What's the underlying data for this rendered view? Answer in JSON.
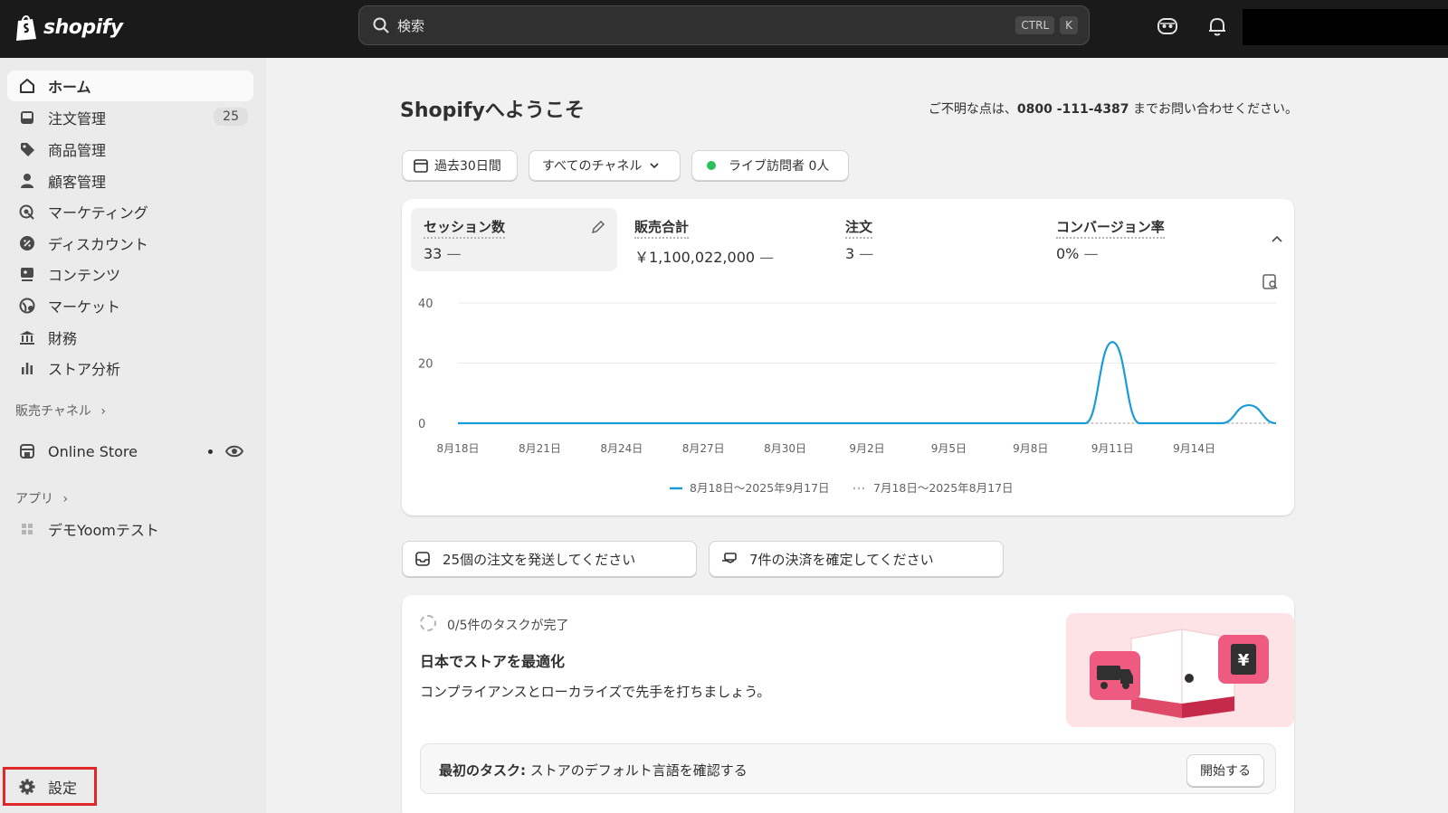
{
  "topbar": {
    "brand": "shopify",
    "search": {
      "placeholder": "検索",
      "shortcut_ctrl": "CTRL",
      "shortcut_key": "K"
    }
  },
  "sidebar": {
    "items": [
      {
        "label": "ホーム",
        "icon": "home-icon",
        "active": true
      },
      {
        "label": "注文管理",
        "icon": "inbox-icon",
        "badge": "25"
      },
      {
        "label": "商品管理",
        "icon": "tag-icon"
      },
      {
        "label": "顧客管理",
        "icon": "person-icon"
      },
      {
        "label": "マーケティング",
        "icon": "target-icon"
      },
      {
        "label": "ディスカウント",
        "icon": "discount-icon"
      },
      {
        "label": "コンテンツ",
        "icon": "content-icon"
      },
      {
        "label": "マーケット",
        "icon": "globe-icon"
      },
      {
        "label": "財務",
        "icon": "bank-icon"
      },
      {
        "label": "ストア分析",
        "icon": "bar-chart-icon"
      }
    ],
    "sales_channels_label": "販売チャネル",
    "online_store_label": "Online Store",
    "apps_label": "アプリ",
    "app_item_label": "デモYoomテスト",
    "settings_label": "設定"
  },
  "main": {
    "title": "Shopifyへようこそ",
    "help_prefix": "ご不明な点は、",
    "help_phone": "0800 -111-4387",
    "help_suffix": " までお問い合わせください。",
    "filters": {
      "date": "過去30日間",
      "channel": "すべてのチャネル",
      "live": "ライブ訪問者 0人"
    },
    "metrics": [
      {
        "label": "セッション数",
        "value": "33"
      },
      {
        "label": "販売合計",
        "value": "￥1,100,022,000"
      },
      {
        "label": "注文",
        "value": "3"
      },
      {
        "label": "コンバージョン率",
        "value": "0%"
      }
    ],
    "tasks": {
      "ship": "25個の注文を発送してください",
      "payments": "7件の決済を確定してください"
    },
    "setup": {
      "progress": "0/5件のタスクが完了",
      "heading": "日本でストアを最適化",
      "desc": "コンプライアンスとローカライズで先手を打ちましょう。",
      "first_task_prefix": "最初のタスク:",
      "first_task": " ストアのデフォルト言語を確認する",
      "start_button": "開始する"
    }
  },
  "chart_data": {
    "type": "line",
    "y_ticks": [
      "40",
      "20",
      "0"
    ],
    "ylim": [
      0,
      40
    ],
    "x_tick_labels": [
      "8月18日",
      "8月21日",
      "8月24日",
      "8月27日",
      "8月30日",
      "9月2日",
      "9月5日",
      "9月8日",
      "9月11日",
      "9月14日"
    ],
    "grid": true,
    "legend_position": "bottom-center",
    "series": [
      {
        "name": "8月18日〜2025年9月17日",
        "color": "#1a9bd7",
        "style": "solid",
        "x": [
          "8月18日",
          "8月19日",
          "8月20日",
          "8月21日",
          "8月22日",
          "8月23日",
          "8月24日",
          "8月25日",
          "8月26日",
          "8月27日",
          "8月28日",
          "8月29日",
          "8月30日",
          "8月31日",
          "9月1日",
          "9月2日",
          "9月3日",
          "9月4日",
          "9月5日",
          "9月6日",
          "9月7日",
          "9月8日",
          "9月9日",
          "9月10日",
          "9月11日",
          "9月12日",
          "9月13日",
          "9月14日",
          "9月15日",
          "9月16日",
          "9月17日"
        ],
        "values": [
          0,
          0,
          0,
          0,
          0,
          0,
          0,
          0,
          0,
          0,
          0,
          0,
          0,
          0,
          0,
          0,
          0,
          0,
          0,
          0,
          0,
          0,
          0,
          0,
          27,
          0,
          0,
          0,
          0,
          6,
          0
        ]
      },
      {
        "name": "7月18日〜2025年8月17日",
        "color": "#b5b5b5",
        "style": "dotted",
        "values": [
          0,
          0,
          0,
          0,
          0,
          0,
          0,
          0,
          0,
          0,
          0,
          0,
          0,
          0,
          0,
          0,
          0,
          0,
          0,
          0,
          0,
          0,
          0,
          0,
          0,
          0,
          0,
          0,
          0,
          0,
          0
        ]
      }
    ]
  }
}
